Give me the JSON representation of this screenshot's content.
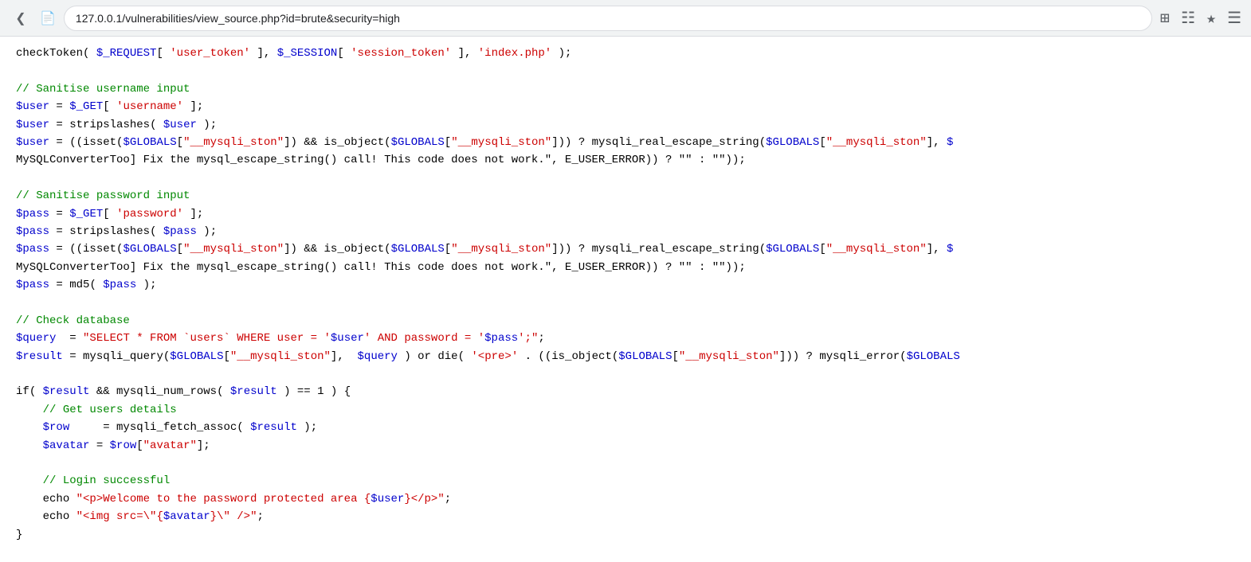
{
  "browser": {
    "url": "127.0.0.1/vulnerabilities/view_source.php?id=brute&security=high",
    "favicon": "📄",
    "icons": {
      "qr": "▦",
      "list": "☰",
      "bookmark": "☆",
      "menu": "≡"
    }
  },
  "code": {
    "lines": [
      "checkToken( $_REQUEST[ 'user_token' ], $_SESSION[ 'session_token' ], 'index.php' );",
      "",
      "// Sanitise username input",
      "$user = $_GET[ 'username' ];",
      "$user = stripslashes( $user );",
      "$user = ((isset($GLOBALS[\"__mysqli_ston\"]) && is_object($GLOBALS[\"__mysqli_ston\"])) ? mysqli_real_escape_string($GLOBALS[\"__mysqli_ston\"], $",
      "MySQLConverterToo] Fix the mysql_escape_string() call! This code does not work.\", E_USER_ERROR)) ? \"\" : \"\"));",
      "",
      "// Sanitise password input",
      "$pass = $_GET[ 'password' ];",
      "$pass = stripslashes( $pass );",
      "$pass = ((isset($GLOBALS[\"__mysqli_ston\"]) && is_object($GLOBALS[\"__mysqli_ston\"])) ? mysqli_real_escape_string($GLOBALS[\"__mysqli_ston\"], $",
      "MySQLConverterToo] Fix the mysql_escape_string() call! This code does not work.\", E_USER_ERROR)) ? \"\" : \"\"));",
      "$pass = md5( $pass );",
      "",
      "// Check database",
      "$query  = \"SELECT * FROM `users` WHERE user = '$user' AND password = '$pass';\";",
      "$result = mysqli_query($GLOBALS[\"__mysqli_ston\"],  $query ) or die( '<pre>' . ((is_object($GLOBALS[\"__mysqli_ston\"])) ? mysqli_error($GLOBALS",
      "",
      "if( $result && mysqli_num_rows( $result ) == 1 ) {",
      "    // Get users details",
      "    $row     = mysqli_fetch_assoc( $result );",
      "    $avatar = $row[\"avatar\"];",
      "",
      "    // Login successful",
      "    echo \"<p>Welcome to the password protected area {$user}</p>\";",
      "    echo \"<img src=\\\"{$avatar}\\\" />\";",
      "}"
    ]
  }
}
